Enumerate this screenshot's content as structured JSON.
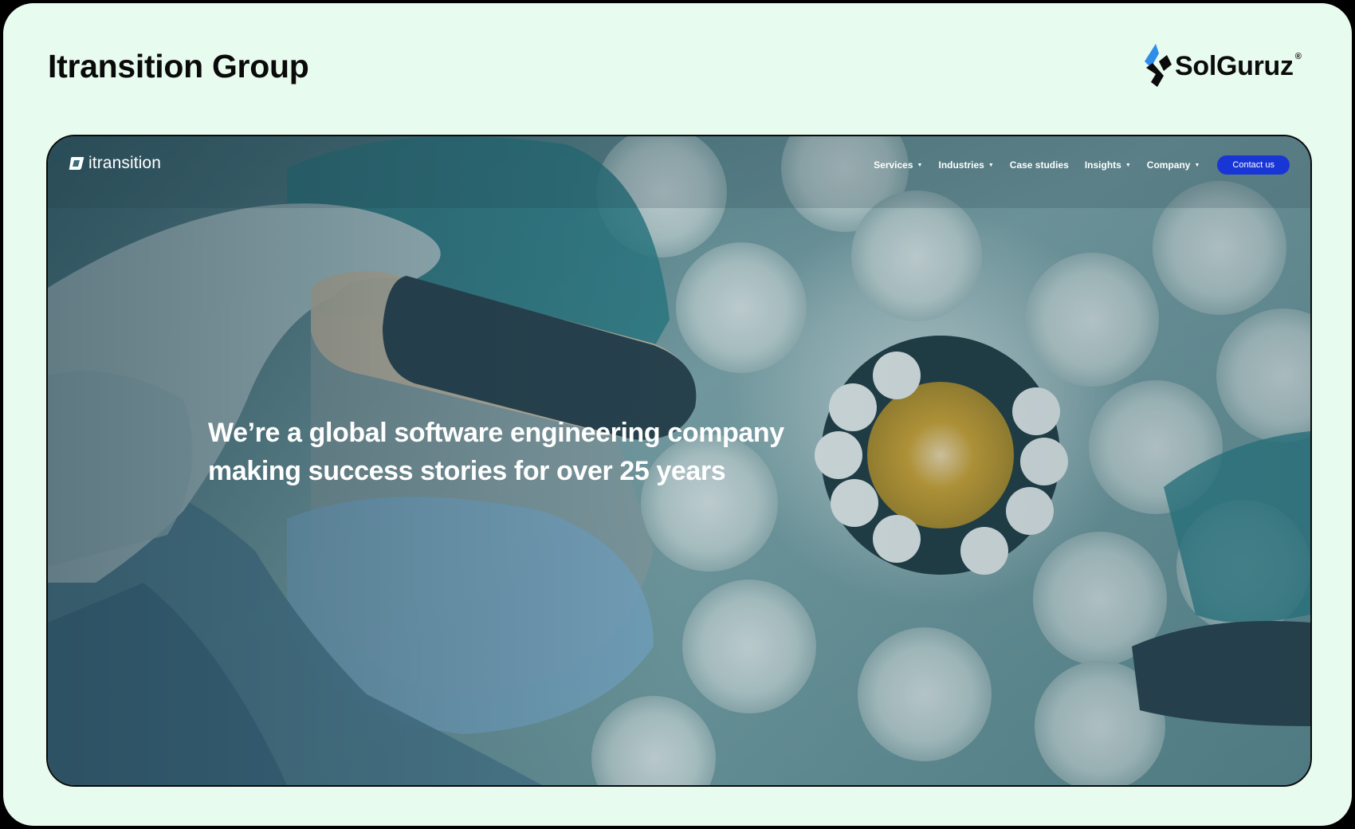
{
  "card": {
    "title": "Itransition Group"
  },
  "brand": {
    "name": "SolGuruz",
    "registered_mark": "®"
  },
  "site": {
    "logo_text": "itransition",
    "nav": [
      {
        "label": "Services",
        "has_dropdown": true
      },
      {
        "label": "Industries",
        "has_dropdown": true
      },
      {
        "label": "Case studies",
        "has_dropdown": false
      },
      {
        "label": "Insights",
        "has_dropdown": true
      },
      {
        "label": "Company",
        "has_dropdown": true
      }
    ],
    "contact_label": "Contact us",
    "hero": {
      "line1": "We’re a global software engineering company",
      "line2": "making success stories for over 25 years"
    }
  },
  "colors": {
    "card_background": "#e8fbef",
    "contact_button": "#1835d6",
    "brand_blue": "#2f8dea"
  },
  "icons": {
    "site_logo": "itransition-logo-icon",
    "brand_logo": "solguruz-logo-icon",
    "caret": "caret-down-icon"
  }
}
